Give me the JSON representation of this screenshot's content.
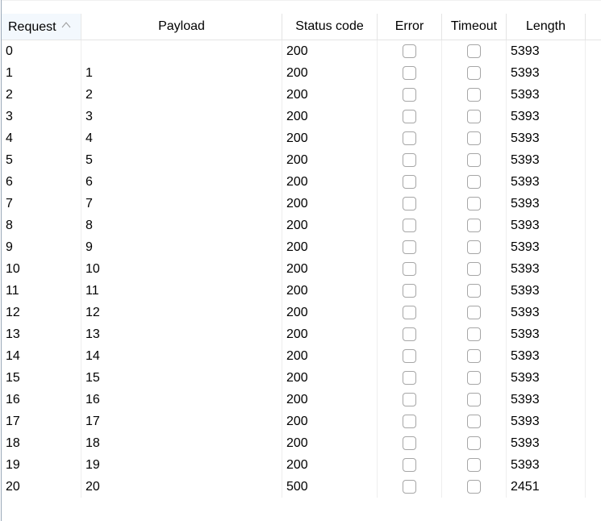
{
  "columns": {
    "request": "Request",
    "payload": "Payload",
    "status": "Status code",
    "error": "Error",
    "timeout": "Timeout",
    "length": "Length"
  },
  "sort": {
    "column": "Request",
    "direction": "ascending",
    "icon": "sort-ascending-icon"
  },
  "rows": [
    {
      "request": "0",
      "payload": "",
      "status": "200",
      "error": false,
      "timeout": false,
      "length": "5393"
    },
    {
      "request": "1",
      "payload": "1",
      "status": "200",
      "error": false,
      "timeout": false,
      "length": "5393"
    },
    {
      "request": "2",
      "payload": "2",
      "status": "200",
      "error": false,
      "timeout": false,
      "length": "5393"
    },
    {
      "request": "3",
      "payload": "3",
      "status": "200",
      "error": false,
      "timeout": false,
      "length": "5393"
    },
    {
      "request": "4",
      "payload": "4",
      "status": "200",
      "error": false,
      "timeout": false,
      "length": "5393"
    },
    {
      "request": "5",
      "payload": "5",
      "status": "200",
      "error": false,
      "timeout": false,
      "length": "5393"
    },
    {
      "request": "6",
      "payload": "6",
      "status": "200",
      "error": false,
      "timeout": false,
      "length": "5393"
    },
    {
      "request": "7",
      "payload": "7",
      "status": "200",
      "error": false,
      "timeout": false,
      "length": "5393"
    },
    {
      "request": "8",
      "payload": "8",
      "status": "200",
      "error": false,
      "timeout": false,
      "length": "5393"
    },
    {
      "request": "9",
      "payload": "9",
      "status": "200",
      "error": false,
      "timeout": false,
      "length": "5393"
    },
    {
      "request": "10",
      "payload": "10",
      "status": "200",
      "error": false,
      "timeout": false,
      "length": "5393"
    },
    {
      "request": "11",
      "payload": "11",
      "status": "200",
      "error": false,
      "timeout": false,
      "length": "5393"
    },
    {
      "request": "12",
      "payload": "12",
      "status": "200",
      "error": false,
      "timeout": false,
      "length": "5393"
    },
    {
      "request": "13",
      "payload": "13",
      "status": "200",
      "error": false,
      "timeout": false,
      "length": "5393"
    },
    {
      "request": "14",
      "payload": "14",
      "status": "200",
      "error": false,
      "timeout": false,
      "length": "5393"
    },
    {
      "request": "15",
      "payload": "15",
      "status": "200",
      "error": false,
      "timeout": false,
      "length": "5393"
    },
    {
      "request": "16",
      "payload": "16",
      "status": "200",
      "error": false,
      "timeout": false,
      "length": "5393"
    },
    {
      "request": "17",
      "payload": "17",
      "status": "200",
      "error": false,
      "timeout": false,
      "length": "5393"
    },
    {
      "request": "18",
      "payload": "18",
      "status": "200",
      "error": false,
      "timeout": false,
      "length": "5393"
    },
    {
      "request": "19",
      "payload": "19",
      "status": "200",
      "error": false,
      "timeout": false,
      "length": "5393"
    },
    {
      "request": "20",
      "payload": "20",
      "status": "500",
      "error": false,
      "timeout": false,
      "length": "2451"
    }
  ]
}
